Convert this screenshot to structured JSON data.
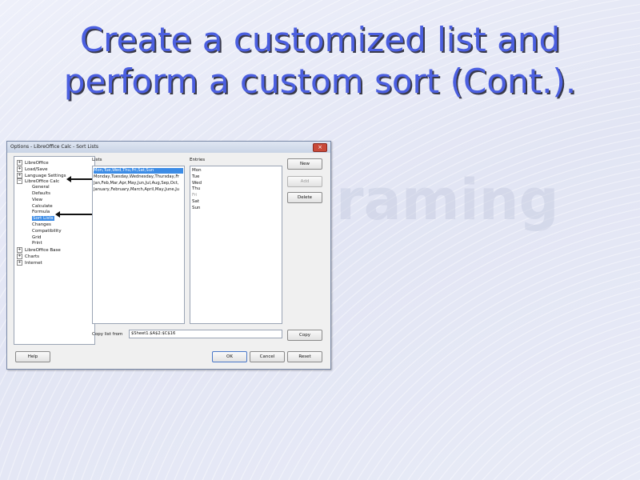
{
  "slide": {
    "title": "Create a customized list and perform a custom sort (Cont.)."
  },
  "dialog": {
    "title": "Options - LibreOffice Calc - Sort Lists",
    "close_label": "×",
    "tree": [
      {
        "label": "LibreOffice",
        "expander": "+"
      },
      {
        "label": "Load/Save",
        "expander": "+"
      },
      {
        "label": "Language Settings",
        "expander": "+"
      },
      {
        "label": "LibreOffice Calc",
        "expander": "−"
      },
      {
        "label": "General",
        "expander": ""
      },
      {
        "label": "Defaults",
        "expander": ""
      },
      {
        "label": "View",
        "expander": ""
      },
      {
        "label": "Calculate",
        "expander": ""
      },
      {
        "label": "Formula",
        "expander": ""
      },
      {
        "label": "Sort Lists",
        "expander": ""
      },
      {
        "label": "Changes",
        "expander": ""
      },
      {
        "label": "Compatibility",
        "expander": ""
      },
      {
        "label": "Grid",
        "expander": ""
      },
      {
        "label": "Print",
        "expander": ""
      },
      {
        "label": "LibreOffice Base",
        "expander": "+"
      },
      {
        "label": "Charts",
        "expander": "+"
      },
      {
        "label": "Internet",
        "expander": "+"
      }
    ],
    "lists_label": "Lists",
    "lists": [
      "Mon,Tue,Wed,Thu,Fri,Sat,Sun",
      "Monday,Tuesday,Wednesday,Thursday,Fr",
      "Jan,Feb,Mar,Apr,May,Jun,Jul,Aug,Sep,Oct,",
      "January,February,March,April,May,June,Ju"
    ],
    "entries_label": "Entries",
    "entries": [
      "Mon",
      "Tue",
      "Wed",
      "Thu",
      "Fri",
      "Sat",
      "Sun"
    ],
    "copy_from_label": "Copy list from",
    "copy_from_value": "$Sheet1.$A$2:$C$16",
    "buttons": {
      "new": "New",
      "add": "Add",
      "delete": "Delete",
      "copy": "Copy",
      "help": "Help",
      "ok": "OK",
      "cancel": "Cancel",
      "reset": "Reset"
    }
  },
  "watermark": "raming"
}
